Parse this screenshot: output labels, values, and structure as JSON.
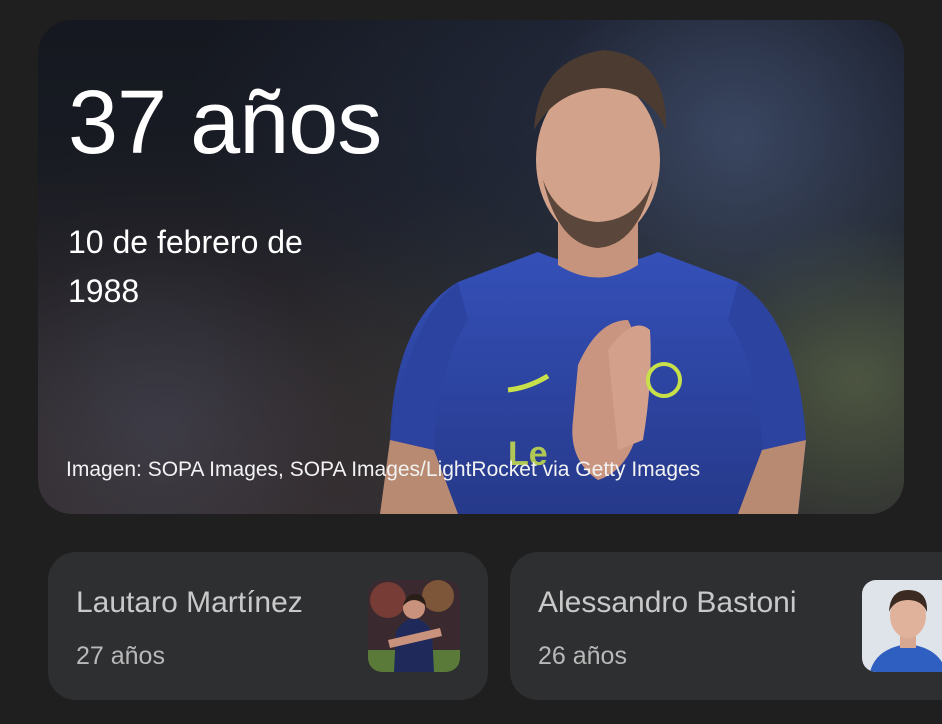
{
  "hero": {
    "age": "37 años",
    "birth_date": "10 de febrero de 1988",
    "image_credit": "Imagen: SOPA Images, SOPA Images/LightRocket via Getty Images",
    "image_icon": "soccer-player-photo"
  },
  "related": [
    {
      "name": "Lautaro Martínez",
      "age": "27 años",
      "image_icon": "player-thumbnail"
    },
    {
      "name": "Alessandro Bastoni",
      "age": "26 años",
      "image_icon": "player-thumbnail"
    }
  ],
  "colors": {
    "background": "#1f1f1f",
    "card": "#2e2f31",
    "jersey_blue": "#2f47a8",
    "accent_yellow": "#c8e04a"
  }
}
